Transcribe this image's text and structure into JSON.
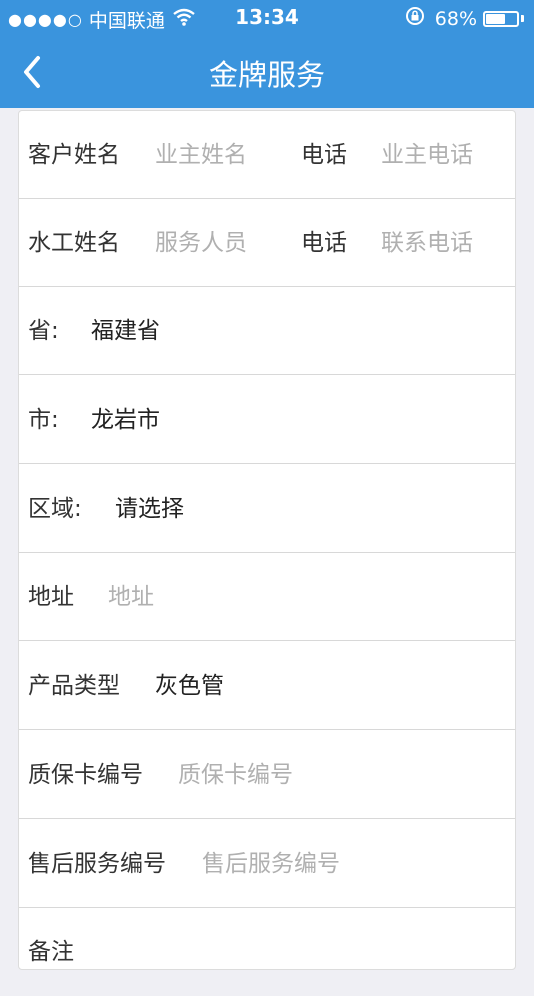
{
  "status_bar": {
    "signal_dots": "●●●●○",
    "carrier": "中国联通",
    "time": "13:34",
    "battery_percent": "68%",
    "battery_level": 0.68
  },
  "nav": {
    "title": "金牌服务"
  },
  "form": {
    "customer_name_label": "客户姓名",
    "customer_name_placeholder": "业主姓名",
    "customer_phone_label": "电话",
    "customer_phone_placeholder": "业主电话",
    "plumber_name_label": "水工姓名",
    "plumber_name_placeholder": "服务人员",
    "plumber_phone_label": "电话",
    "plumber_phone_placeholder": "联系电话",
    "province_label": "省:",
    "province_value": "福建省",
    "city_label": "市:",
    "city_value": "龙岩市",
    "district_label": "区域:",
    "district_value": "请选择",
    "address_label": "地址",
    "address_placeholder": "地址",
    "product_type_label": "产品类型",
    "product_type_value": "灰色管",
    "warranty_card_label": "质保卡编号",
    "warranty_card_placeholder": "质保卡编号",
    "after_sales_label": "售后服务编号",
    "after_sales_placeholder": "售后服务编号",
    "remark_label": "备注"
  }
}
